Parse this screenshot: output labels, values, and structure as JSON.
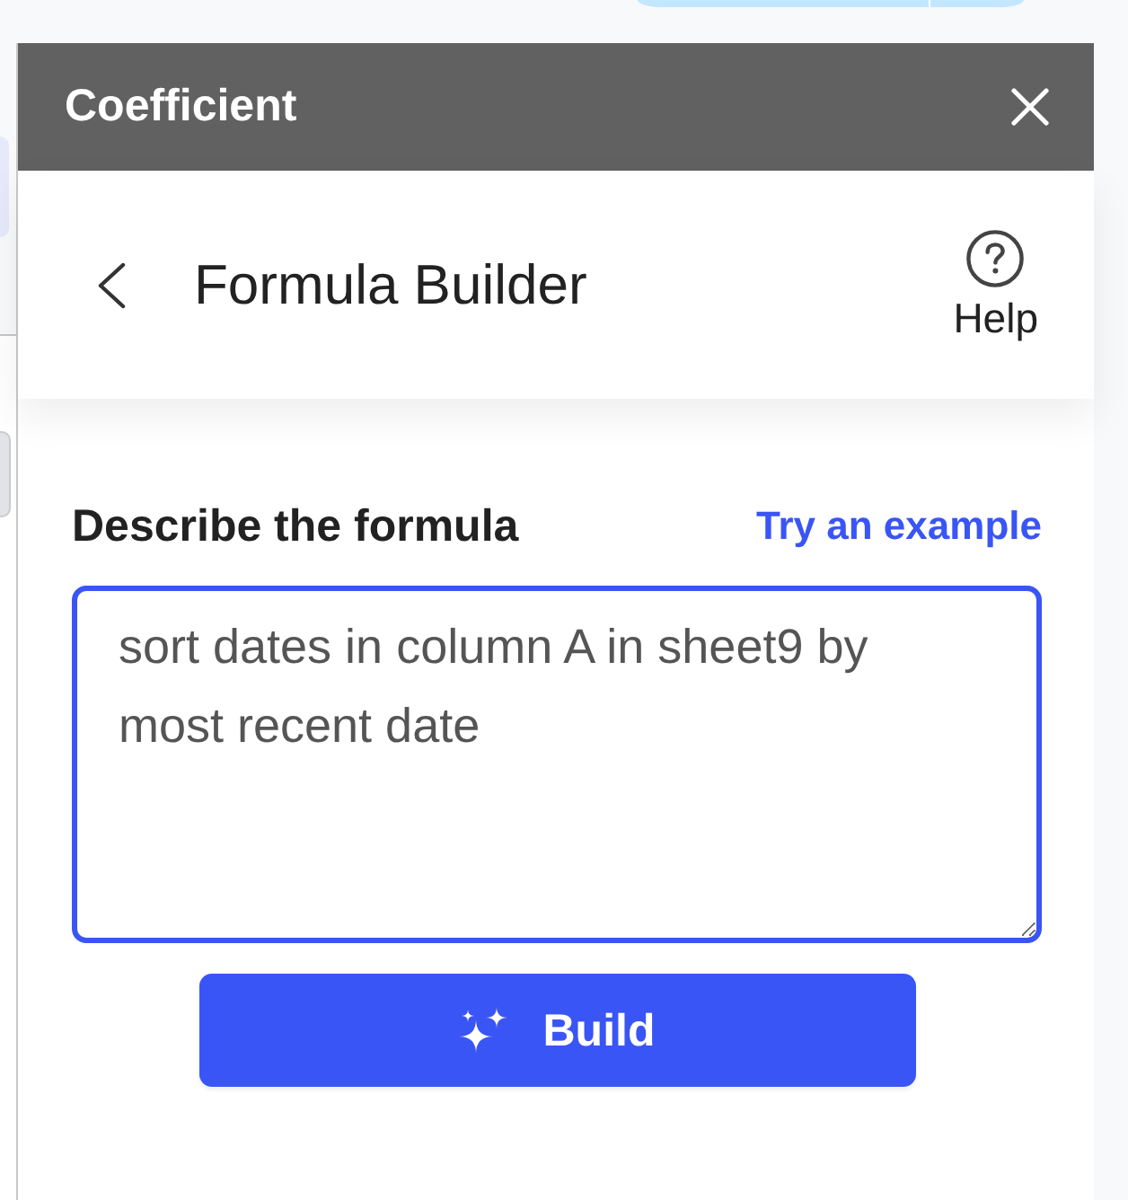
{
  "window": {
    "title": "Coefficient"
  },
  "header": {
    "title": "Formula Builder",
    "help_label": "Help"
  },
  "form": {
    "label": "Describe the formula",
    "example_link": "Try an example",
    "input": {
      "value": "sort dates in column A in sheet9 by most recent date",
      "focused": true
    }
  },
  "build_button": {
    "label": "Build"
  }
}
